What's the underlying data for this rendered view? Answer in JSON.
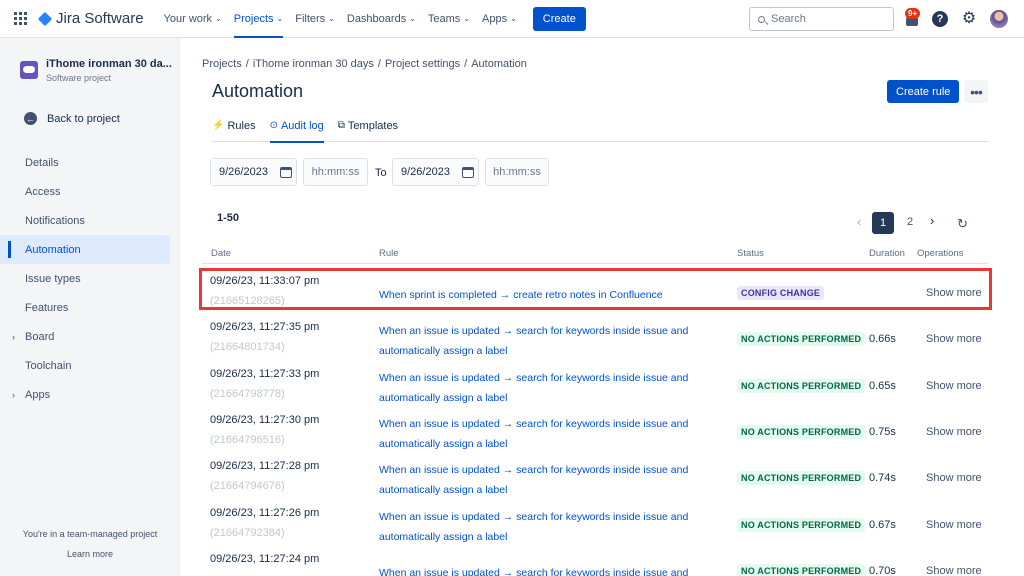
{
  "topnav": {
    "logo": "Jira Software",
    "items": [
      {
        "label": "Your work",
        "dropdown": true,
        "active": false
      },
      {
        "label": "Projects",
        "dropdown": true,
        "active": true
      },
      {
        "label": "Filters",
        "dropdown": true,
        "active": false
      },
      {
        "label": "Dashboards",
        "dropdown": true,
        "active": false
      },
      {
        "label": "Teams",
        "dropdown": true,
        "active": false
      },
      {
        "label": "Apps",
        "dropdown": true,
        "active": false
      }
    ],
    "create_label": "Create",
    "search_placeholder": "Search",
    "notif_badge": "9+",
    "help_glyph": "?"
  },
  "sidebar": {
    "project_name": "iThome ironman 30 da...",
    "project_type": "Software project",
    "back_label": "Back to project",
    "items": [
      {
        "label": "Details",
        "active": false,
        "expandable": false
      },
      {
        "label": "Access",
        "active": false,
        "expandable": false
      },
      {
        "label": "Notifications",
        "active": false,
        "expandable": false
      },
      {
        "label": "Automation",
        "active": true,
        "expandable": false
      },
      {
        "label": "Issue types",
        "active": false,
        "expandable": false
      },
      {
        "label": "Features",
        "active": false,
        "expandable": false
      },
      {
        "label": "Board",
        "active": false,
        "expandable": true
      },
      {
        "label": "Toolchain",
        "active": false,
        "expandable": false
      },
      {
        "label": "Apps",
        "active": false,
        "expandable": true
      }
    ],
    "footer_text": "You're in a team-managed project",
    "learn_more": "Learn more"
  },
  "main": {
    "breadcrumbs": [
      "Projects",
      "iThome ironman 30 days",
      "Project settings",
      "Automation"
    ],
    "title": "Automation",
    "create_rule_label": "Create rule",
    "tabs": [
      {
        "label": "Rules",
        "active": false
      },
      {
        "label": "Audit log",
        "active": true
      },
      {
        "label": "Templates",
        "active": false
      }
    ],
    "filter": {
      "from_date": "9/26/2023",
      "from_time_placeholder": "hh:mm:ss",
      "to_label": "To",
      "to_date": "9/26/2023",
      "to_time_placeholder": "hh:mm:ss"
    },
    "range_label": "1-50",
    "pagination": {
      "prev": "‹",
      "current": "1",
      "next_page": "2",
      "next": "›"
    },
    "columns": [
      "Date",
      "Rule",
      "Status",
      "Duration",
      "Operations"
    ],
    "rows": [
      {
        "date": "09/26/23, 11:33:07 pm",
        "id": "(21665128265)",
        "rule_line1": "When sprint is completed → create retro notes in Confluence",
        "rule_line2": "",
        "status": "CONFIG CHANGE",
        "status_kind": "config",
        "duration": "",
        "op": "Show more",
        "highlighted": true
      },
      {
        "date": "09/26/23, 11:27:35 pm",
        "id": "(21664801734)",
        "rule_line1": "When an issue is updated → search for keywords inside issue and",
        "rule_line2": "automatically assign a label",
        "status": "NO ACTIONS PERFORMED",
        "status_kind": "noact",
        "duration": "0.66s",
        "op": "Show more",
        "highlighted": false
      },
      {
        "date": "09/26/23, 11:27:33 pm",
        "id": "(21664798778)",
        "rule_line1": "When an issue is updated → search for keywords inside issue and",
        "rule_line2": "automatically assign a label",
        "status": "NO ACTIONS PERFORMED",
        "status_kind": "noact",
        "duration": "0.65s",
        "op": "Show more",
        "highlighted": false
      },
      {
        "date": "09/26/23, 11:27:30 pm",
        "id": "(21664796516)",
        "rule_line1": "When an issue is updated → search for keywords inside issue and",
        "rule_line2": "automatically assign a label",
        "status": "NO ACTIONS PERFORMED",
        "status_kind": "noact",
        "duration": "0.75s",
        "op": "Show more",
        "highlighted": false
      },
      {
        "date": "09/26/23, 11:27:28 pm",
        "id": "(21664794676)",
        "rule_line1": "When an issue is updated → search for keywords inside issue and",
        "rule_line2": "automatically assign a label",
        "status": "NO ACTIONS PERFORMED",
        "status_kind": "noact",
        "duration": "0.74s",
        "op": "Show more",
        "highlighted": false
      },
      {
        "date": "09/26/23, 11:27:26 pm",
        "id": "(21664792384)",
        "rule_line1": "When an issue is updated → search for keywords inside issue and",
        "rule_line2": "automatically assign a label",
        "status": "NO ACTIONS PERFORMED",
        "status_kind": "noact",
        "duration": "0.67s",
        "op": "Show more",
        "highlighted": false
      },
      {
        "date": "09/26/23, 11:27:24 pm",
        "id": "",
        "rule_line1": "When an issue is updated → search for keywords inside issue and",
        "rule_line2": "",
        "status": "NO ACTIONS PERFORMED",
        "status_kind": "noact",
        "duration": "0.70s",
        "op": "Show more",
        "highlighted": false
      }
    ]
  },
  "colors": {
    "brand": "#0052cc",
    "highlight": "#e53935",
    "noact_bg": "#e3fcef",
    "config_bg": "#eae6ff"
  }
}
